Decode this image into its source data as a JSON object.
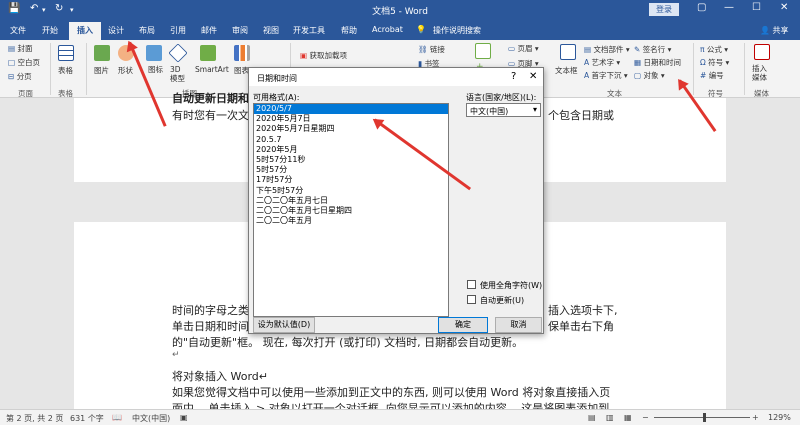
{
  "titlebar": {
    "save_icon": "💾",
    "undo": "↶",
    "redo": "↻",
    "title": "文档5 - Word",
    "login": "登录",
    "restore_icon": "▢",
    "minimize": "—",
    "maximize": "☐",
    "close": "✕"
  },
  "tabs": {
    "file": "文件",
    "start": "开始",
    "insert": "插入",
    "design": "设计",
    "layout": "布局",
    "references": "引用",
    "mailings": "邮件",
    "review": "审阅",
    "view": "视图",
    "developer": "开发工具",
    "help": "帮助",
    "acrobat": "Acrobat",
    "tell_me": "操作说明搜索",
    "share": "共享"
  },
  "ribbon": {
    "cover": "封面",
    "blank": "空白页",
    "pagebreak": "分页",
    "pages_group": "页面",
    "table": "表格",
    "tables_group": "表格",
    "pictures": "图片",
    "shapes": "形状",
    "icons": "图标",
    "model3d": "3D 模型",
    "smartart": "SmartArt",
    "chart": "图表",
    "illustrations_group": "插图",
    "addins": "获取加载项",
    "links": "链接",
    "bookmark": "书签",
    "comment": "批注",
    "header": "页眉",
    "footer": "页脚",
    "textbox": "文本框",
    "docparts": "文档部件",
    "wordart": "艺术字",
    "dropcap": "首字下沉",
    "signature": "签名行",
    "datetime": "日期和时间",
    "object": "对象",
    "text_group": "文本",
    "equation": "公式",
    "symbol": "符号",
    "number": "编号",
    "symbols_group": "符号",
    "media": "插入媒体",
    "media_group": "媒体"
  },
  "doc": {
    "p1_heading": "自动更新日期和时间",
    "p1_line": "有时您有一次文",
    "p1_line_end": "个包含日期或",
    "p2_l1a": "时间的字母之类",
    "p2_l1b": "插入选项卡下,",
    "p2_l2a": "单击日期和时间",
    "p2_l2b": "保单击右下角",
    "p2_l3": "的\"自动更新\"框。 现在, 每次打开 (或打印) 文档时, 日期都会自动更新。",
    "p2_mark": "↵",
    "p3_title": "将对象插入 Word↵",
    "p3_l1": "如果您觉得文档中可以使用一些添加到正文中的东西, 则可以使用 Word 将对象直接插入页",
    "p3_l2": "面中。 单击插入 > 对象以打开一个对话框, 向您显示可以添加的内容。 这是将图表添加到"
  },
  "dialog": {
    "title": "日期和时间",
    "help": "?",
    "close": "✕",
    "formats_label": "可用格式(A):",
    "formats": [
      "2020/5/7",
      "2020年5月7日",
      "2020年5月7日星期四",
      "20.5.7",
      "2020年5月",
      "5时57分11秒",
      "5时57分",
      "17时57分",
      "下午5时57分",
      "二〇二〇年五月七日",
      "二〇二〇年五月七日星期四",
      "二〇二〇年五月"
    ],
    "language_label": "语言(国家/地区)(L):",
    "language_value": "中文(中国)",
    "fullwidth_label": "使用全角字符(W)",
    "autoupdate_label": "自动更新(U)",
    "set_default": "设为默认值(D)",
    "ok": "确定",
    "cancel": "取消"
  },
  "status": {
    "page": "第 2 页, 共 2 页",
    "words": "631 个字",
    "lang": "中文(中国)",
    "zoom": "129%",
    "minus": "−",
    "plus": "+"
  },
  "colors": {
    "word_blue": "#2b579a",
    "selection": "#0078d7",
    "annotation_red": "#e0362f"
  }
}
